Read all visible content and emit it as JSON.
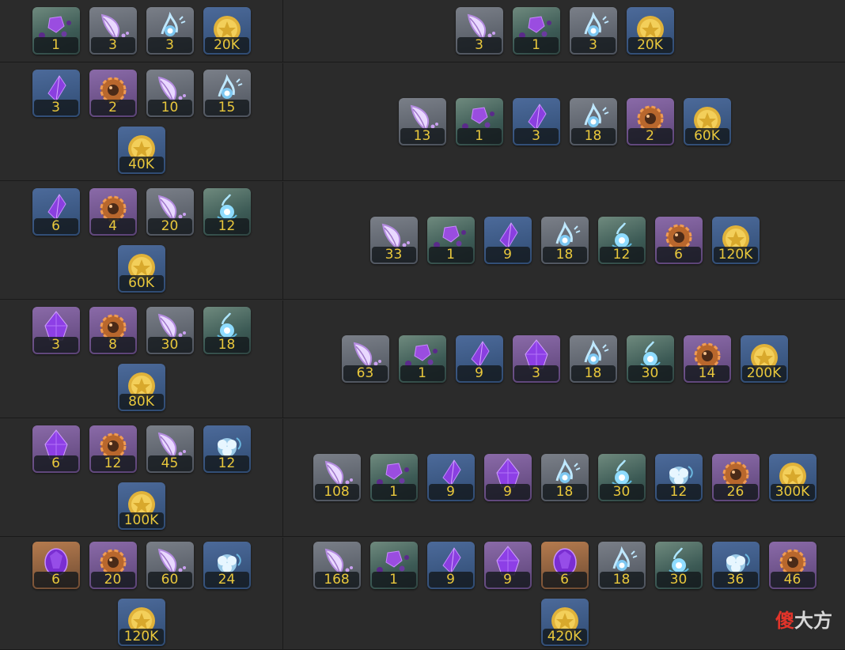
{
  "rows": [
    {
      "left": [
        {
          "icon": "cluster-crystal",
          "qty": "1"
        },
        {
          "icon": "leaf-feather",
          "qty": "3"
        },
        {
          "icon": "blue-spirit",
          "qty": "3"
        },
        {
          "icon": "gold-coin",
          "qty": "20K"
        }
      ],
      "right": [
        {
          "icon": "leaf-feather",
          "qty": "3"
        },
        {
          "icon": "cluster-crystal",
          "qty": "1"
        },
        {
          "icon": "blue-spirit",
          "qty": "3"
        },
        {
          "icon": "gold-coin",
          "qty": "20K"
        }
      ]
    },
    {
      "left": [
        {
          "icon": "purple-shard",
          "qty": "3"
        },
        {
          "icon": "bronze-gear",
          "qty": "2"
        },
        {
          "icon": "leaf-feather",
          "qty": "10"
        },
        {
          "icon": "blue-spirit",
          "qty": "15"
        },
        {
          "icon": "gold-coin",
          "qty": "40K"
        }
      ],
      "right": [
        {
          "icon": "leaf-feather",
          "qty": "13"
        },
        {
          "icon": "cluster-crystal",
          "qty": "1"
        },
        {
          "icon": "purple-shard",
          "qty": "3"
        },
        {
          "icon": "blue-spirit",
          "qty": "18"
        },
        {
          "icon": "bronze-gear",
          "qty": "2"
        },
        {
          "icon": "gold-coin",
          "qty": "60K"
        }
      ]
    },
    {
      "left": [
        {
          "icon": "purple-shard",
          "qty": "6"
        },
        {
          "icon": "bronze-gear",
          "qty": "4"
        },
        {
          "icon": "leaf-feather",
          "qty": "20"
        },
        {
          "icon": "blue-orb",
          "qty": "12"
        },
        {
          "icon": "gold-coin",
          "qty": "60K"
        }
      ],
      "right": [
        {
          "icon": "leaf-feather",
          "qty": "33"
        },
        {
          "icon": "cluster-crystal",
          "qty": "1"
        },
        {
          "icon": "purple-shard",
          "qty": "9"
        },
        {
          "icon": "blue-spirit",
          "qty": "18"
        },
        {
          "icon": "blue-orb",
          "qty": "12"
        },
        {
          "icon": "bronze-gear",
          "qty": "6"
        },
        {
          "icon": "gold-coin",
          "qty": "120K"
        }
      ]
    },
    {
      "left": [
        {
          "icon": "big-purple-crystal",
          "qty": "3"
        },
        {
          "icon": "bronze-gear",
          "qty": "8"
        },
        {
          "icon": "leaf-feather",
          "qty": "30"
        },
        {
          "icon": "blue-orb",
          "qty": "18"
        },
        {
          "icon": "gold-coin",
          "qty": "80K"
        }
      ],
      "right": [
        {
          "icon": "leaf-feather",
          "qty": "63"
        },
        {
          "icon": "cluster-crystal",
          "qty": "1"
        },
        {
          "icon": "purple-shard",
          "qty": "9"
        },
        {
          "icon": "big-purple-crystal",
          "qty": "3"
        },
        {
          "icon": "blue-spirit",
          "qty": "18"
        },
        {
          "icon": "blue-orb",
          "qty": "30"
        },
        {
          "icon": "bronze-gear",
          "qty": "14"
        },
        {
          "icon": "gold-coin",
          "qty": "200K"
        }
      ]
    },
    {
      "left": [
        {
          "icon": "big-purple-crystal",
          "qty": "6"
        },
        {
          "icon": "bronze-gear",
          "qty": "12"
        },
        {
          "icon": "leaf-feather",
          "qty": "45"
        },
        {
          "icon": "blue-flower",
          "qty": "12"
        },
        {
          "icon": "gold-coin",
          "qty": "100K"
        }
      ],
      "right": [
        {
          "icon": "leaf-feather",
          "qty": "108"
        },
        {
          "icon": "cluster-crystal",
          "qty": "1"
        },
        {
          "icon": "purple-shard",
          "qty": "9"
        },
        {
          "icon": "big-purple-crystal",
          "qty": "9"
        },
        {
          "icon": "blue-spirit",
          "qty": "18"
        },
        {
          "icon": "blue-orb",
          "qty": "30"
        },
        {
          "icon": "blue-flower",
          "qty": "12"
        },
        {
          "icon": "bronze-gear",
          "qty": "26"
        },
        {
          "icon": "gold-coin",
          "qty": "300K"
        }
      ]
    },
    {
      "left": [
        {
          "icon": "purple-egg-gem",
          "qty": "6"
        },
        {
          "icon": "bronze-gear",
          "qty": "20"
        },
        {
          "icon": "leaf-feather",
          "qty": "60"
        },
        {
          "icon": "blue-flower",
          "qty": "24"
        },
        {
          "icon": "gold-coin",
          "qty": "120K"
        }
      ],
      "right": [
        {
          "icon": "leaf-feather",
          "qty": "168"
        },
        {
          "icon": "cluster-crystal",
          "qty": "1"
        },
        {
          "icon": "purple-shard",
          "qty": "9"
        },
        {
          "icon": "big-purple-crystal",
          "qty": "9"
        },
        {
          "icon": "purple-egg-gem",
          "qty": "6"
        },
        {
          "icon": "blue-spirit",
          "qty": "18"
        },
        {
          "icon": "blue-orb",
          "qty": "30"
        },
        {
          "icon": "blue-flower",
          "qty": "36"
        },
        {
          "icon": "bronze-gear",
          "qty": "46"
        },
        {
          "icon": "gold-coin",
          "qty": "420K"
        }
      ]
    }
  ],
  "watermark": {
    "char1": "傻",
    "rest": "大方"
  },
  "colors": {
    "background": "#2b2b2b",
    "grid": "#1a1a1a",
    "quantity_text": "#e9c83c"
  }
}
